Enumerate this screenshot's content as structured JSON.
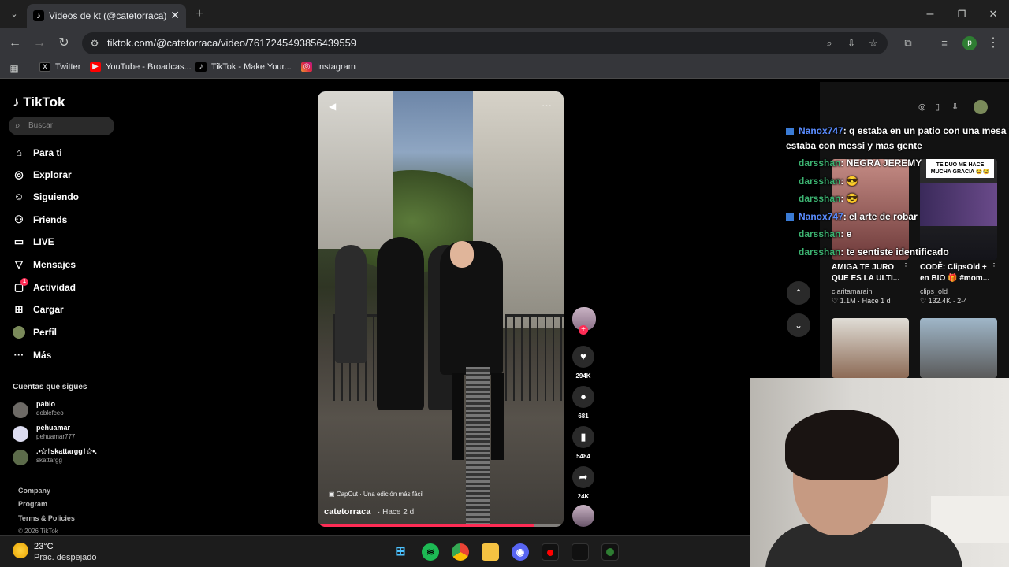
{
  "browser": {
    "tab_title": "Videos de kt (@catetorraca) con",
    "url": "tiktok.com/@catetorraca/video/7617245493856439559",
    "profile_initial": "p",
    "bookmarks": [
      {
        "label": "Twitter",
        "icon": "x-icon",
        "color": "#000000"
      },
      {
        "label": "YouTube - Broadcas...",
        "icon": "youtube-icon",
        "color": "#ff0000"
      },
      {
        "label": "TikTok - Make Your...",
        "icon": "tiktok-icon",
        "color": "#000000"
      },
      {
        "label": "Instagram",
        "icon": "instagram-icon",
        "color": "#d6249f"
      }
    ]
  },
  "tiktok": {
    "logo": "TikTok",
    "search_placeholder": "Buscar",
    "nav": [
      {
        "label": "Para ti",
        "icon": "home-icon"
      },
      {
        "label": "Explorar",
        "icon": "compass-icon"
      },
      {
        "label": "Siguiendo",
        "icon": "following-icon"
      },
      {
        "label": "Friends",
        "icon": "friends-icon"
      },
      {
        "label": "LIVE",
        "icon": "live-icon"
      },
      {
        "label": "Mensajes",
        "icon": "messages-icon"
      },
      {
        "label": "Actividad",
        "icon": "activity-icon",
        "badge": "1"
      },
      {
        "label": "Cargar",
        "icon": "upload-icon"
      },
      {
        "label": "Perfil",
        "icon": "profile-icon"
      },
      {
        "label": "Más",
        "icon": "more-icon"
      }
    ],
    "follows_title": "Cuentas que sigues",
    "follows": [
      {
        "name": "pablo",
        "user": "doblefceo"
      },
      {
        "name": "pehuamar",
        "user": "pehuamar777"
      },
      {
        "name": ".•✩†skattargg†✩•.",
        "user": "skattargg"
      }
    ],
    "footer": [
      "Company",
      "Program",
      "Terms & Policies",
      "© 2026 TikTok"
    ],
    "video": {
      "author": "catetorraca",
      "time": "· Hace 2 d",
      "capcut": "CapCut · Una edición más fácil",
      "progress": 0.88,
      "likes": "294K",
      "comments": "681",
      "saves": "5484",
      "shares": "24K"
    },
    "recommended": [
      {
        "title": "AMIGA TE JURO QUE ES LA ULTI...",
        "user": "claritamarain",
        "stats": "♡ 1.1M · Hace 1 d"
      },
      {
        "title": "CODĚ: ClipsOld + en BIO 🎁 #mom...",
        "user": "clips_old",
        "stats": "♡ 132.4K · 2-4"
      }
    ],
    "thumb_caption": "TE DUO ME HACE MUCHA GRACIA 😂😂"
  },
  "chat": [
    {
      "user": "Nanox747",
      "msg": ": q estaba en un patio con una mesa y",
      "cont": "estaba con messi y mas gente",
      "color": "#5a8cff"
    },
    {
      "user": "darsshan",
      "msg": ": NEGRA JEREMY",
      "color": "#3cb371"
    },
    {
      "user": "darsshan",
      "msg": ":",
      "color": "#3cb371"
    },
    {
      "user": "darsshan",
      "msg": ":",
      "color": "#3cb371"
    },
    {
      "user": "Nanox747",
      "msg": ": el arte de robar",
      "color": "#5a8cff"
    },
    {
      "user": "darsshan",
      "msg": ": e",
      "color": "#3cb371"
    },
    {
      "user": "darsshan",
      "msg": ": te sentiste identificado",
      "color": "#3cb371"
    }
  ],
  "taskbar": {
    "temp": "23°C",
    "weather": "Prac. despejado"
  }
}
